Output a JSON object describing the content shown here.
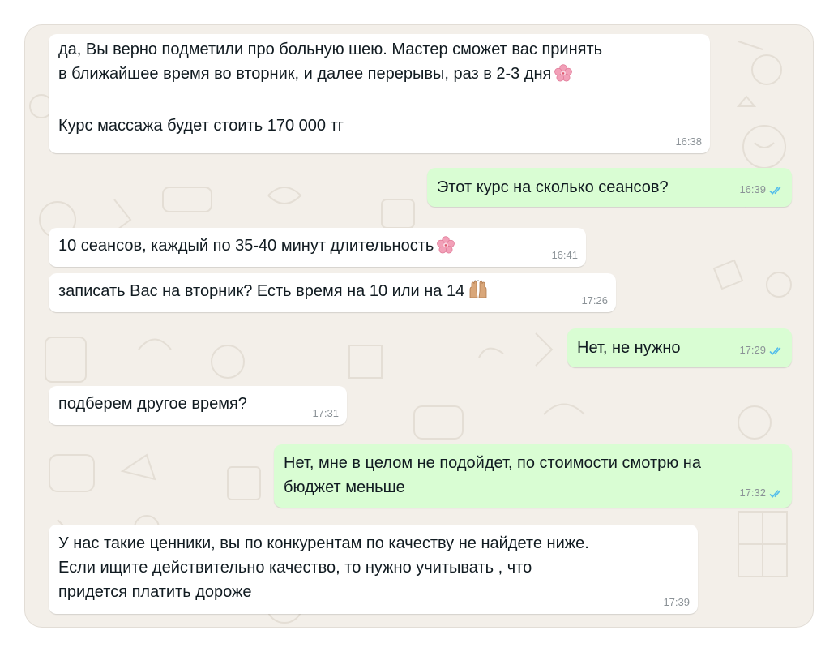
{
  "messages": [
    {
      "direction": "incoming",
      "text": "да, Вы верно подметили про больную шею. Мастер сможет вас принять\nв ближайшее время во вторник, и далее перерывы, раз в 2-3 дня",
      "text2": "\n\nКурс массажа будет стоить 170 000 тг",
      "emoji": "cherry-blossom-icon",
      "time": "16:38"
    },
    {
      "direction": "outgoing",
      "text": "Этот курс на сколько сеансов?",
      "time": "16:39",
      "status": "read"
    },
    {
      "direction": "incoming",
      "text": "10 сеансов, каждый по 35-40 минут длительность",
      "emoji": "cherry-blossom-icon",
      "time": "16:41"
    },
    {
      "direction": "incoming",
      "text": "записать Вас на вторник? Есть время на 10 или на 14",
      "emoji": "raising-hands-icon",
      "time": "17:26"
    },
    {
      "direction": "outgoing",
      "text": "Нет, не нужно",
      "time": "17:29",
      "status": "read"
    },
    {
      "direction": "incoming",
      "text": "подберем другое время?",
      "time": "17:31"
    },
    {
      "direction": "outgoing",
      "text": "Нет, мне в целом не подойдет, по стоимости смотрю на\nбюджет меньше",
      "time": "17:32",
      "status": "read"
    },
    {
      "direction": "incoming",
      "text": "У нас такие ценники, вы по конкурентам по качеству не найдете ниже.\nЕсли ищите действительно качество, то нужно учитывать , что\nпридется платить дороже",
      "time": "17:39"
    }
  ],
  "colors": {
    "incoming_bubble": "#ffffff",
    "outgoing_bubble": "#d9fdd3",
    "read_ticks": "#53bdeb",
    "wallpaper": "#f3efe9"
  }
}
